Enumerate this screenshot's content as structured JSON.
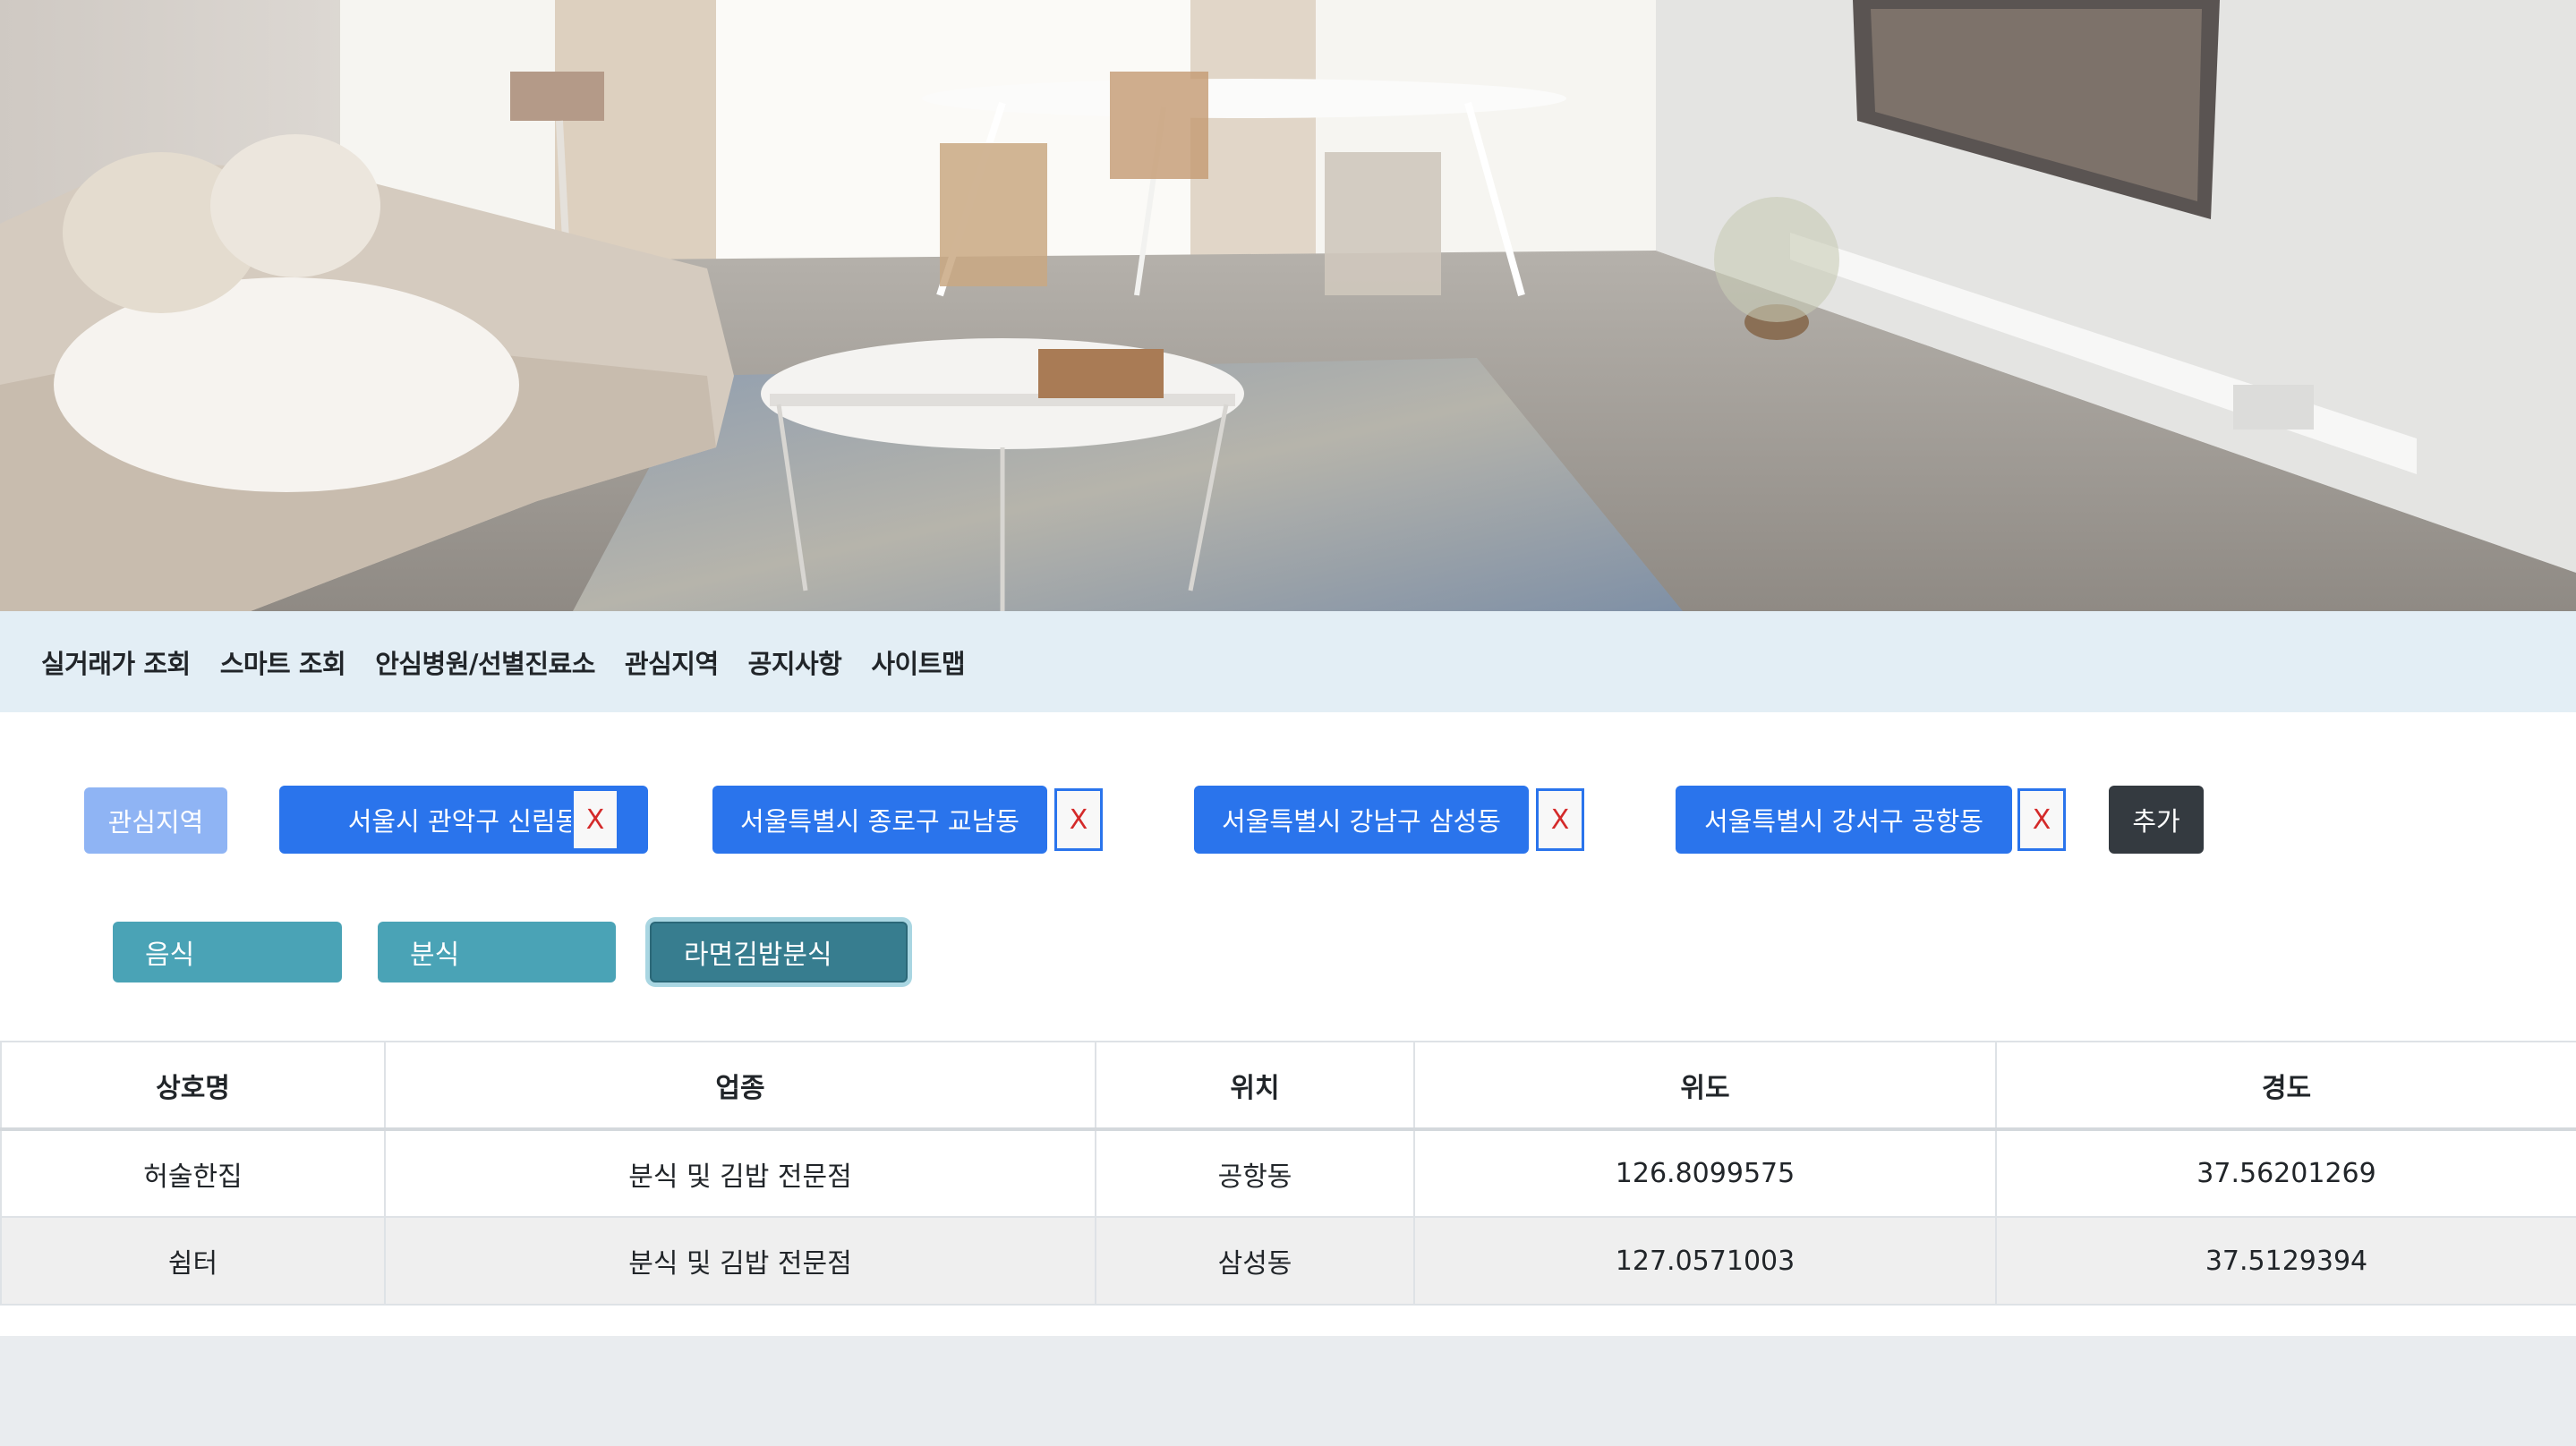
{
  "nav": {
    "items": [
      "실거래가 조회",
      "스마트 조회",
      "안심병원/선별진료소",
      "관심지역",
      "공지사항",
      "사이트맵"
    ]
  },
  "regions": {
    "label": "관심지역",
    "items": [
      "서울시 관악구 신림동",
      "서울특별시 종로구 교남동",
      "서울특별시 강남구 삼성동",
      "서울특별시 강서구 공항동"
    ],
    "remove_label": "X",
    "add_label": "추가"
  },
  "categories": {
    "items": [
      "음식",
      "분식",
      "라면김밥분식"
    ],
    "selected": "라면김밥분식"
  },
  "table": {
    "headers": [
      "상호명",
      "업종",
      "위치",
      "위도",
      "경도"
    ],
    "rows": [
      [
        "허술한집",
        "분식 및 김밥 전문점",
        "공항동",
        "126.8099575",
        "37.56201269"
      ],
      [
        "쉼터",
        "분식 및 김밥 전문점",
        "삼성동",
        "127.0571003",
        "37.5129394"
      ]
    ]
  },
  "colors": {
    "nav_bg": "#e3eef5",
    "region_button": "#2a74ec",
    "label_button": "#8fb4f4",
    "add_button": "#343a40",
    "category_button": "#4aa3b6",
    "category_active": "#377d8f"
  }
}
